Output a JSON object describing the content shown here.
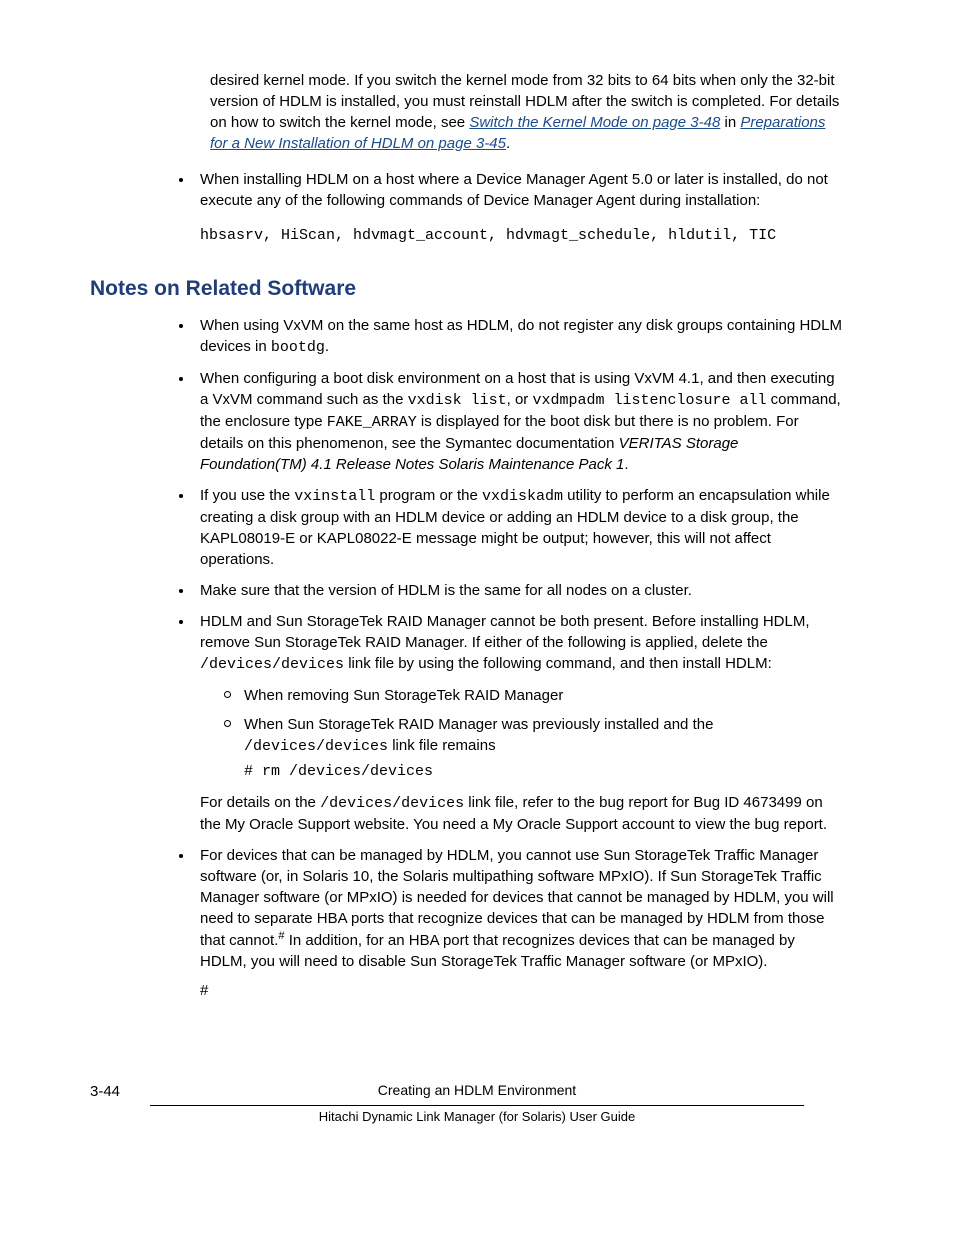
{
  "intro": {
    "p1_a": "desired kernel mode. If you switch the kernel mode from 32 bits to 64 bits when only the 32-bit version of HDLM is installed, you must reinstall HDLM after the switch is completed. For details on how to switch the kernel mode, see ",
    "link1": "Switch the Kernel Mode on page 3-48",
    "p1_b": " in ",
    "link2": "Preparations for a New Installation of HDLM on page 3-45",
    "p1_c": "."
  },
  "bullet_top": {
    "text": "When installing HDLM on a host where a Device Manager Agent 5.0 or later is installed, do not execute any of the following commands of Device Manager Agent during installation:",
    "code": "hbsasrv, HiScan, hdvmagt_account, hdvmagt_schedule, hldutil, TIC"
  },
  "heading": "Notes on Related Software",
  "notes": {
    "n1_a": "When using VxVM on the same host as HDLM, do not register any disk groups containing HDLM devices in ",
    "n1_code": "bootdg",
    "n1_b": ".",
    "n2_a": "When configuring a boot disk environment on a host that is using VxVM 4.1, and then executing a VxVM command such as the ",
    "n2_code1": "vxdisk list",
    "n2_b": ", or ",
    "n2_code2": "vxdmpadm listenclosure all",
    "n2_c": " command, the enclosure type ",
    "n2_code3": "FAKE_ARRAY",
    "n2_d": " is displayed for the boot disk but there is no problem. For details on this phenomenon, see the Symantec documentation ",
    "n2_italic": "VERITAS Storage Foundation(TM) 4.1 Release Notes Solaris Maintenance Pack 1",
    "n2_e": ".",
    "n3_a": "If you use the ",
    "n3_code1": "vxinstall",
    "n3_b": " program or the ",
    "n3_code2": "vxdiskadm",
    "n3_c": " utility to perform an encapsulation while creating a disk group with an HDLM device or adding an HDLM device to a disk group, the KAPL08019-E or KAPL08022-E message might be output; however, this will not affect operations.",
    "n4": "Make sure that the version of HDLM is the same for all nodes on a cluster.",
    "n5_a": "HDLM and Sun StorageTek RAID Manager cannot be both present. Before installing HDLM, remove Sun StorageTek RAID Manager. If either of the following is applied, delete the ",
    "n5_code1": "/devices/devices",
    "n5_b": " link file by using the following command, and then install HDLM:",
    "n5_sub1": "When removing Sun StorageTek RAID Manager",
    "n5_sub2_a": "When Sun StorageTek RAID Manager was previously installed and the ",
    "n5_sub2_code": "/devices/devices",
    "n5_sub2_b": " link file remains",
    "n5_cmd": "# rm /devices/devices",
    "n5_post_a": "For details on the ",
    "n5_post_code": "/devices/devices",
    "n5_post_b": " link file, refer to the bug report for Bug ID 4673499 on the My Oracle Support website. You need a My Oracle Support account to view the bug report.",
    "n6_a": "For devices that can be managed by HDLM, you cannot use Sun StorageTek Traffic Manager software (or, in Solaris 10, the Solaris multipathing software MPxIO). If Sun StorageTek Traffic Manager software (or MPxIO) is needed for devices that cannot be managed by HDLM, you will need to separate HBA ports that recognize devices that can be managed by HDLM from those that cannot.",
    "n6_sup": "#",
    "n6_b": " In addition, for an HBA port that recognizes devices that can be managed by HDLM, you will need to disable Sun StorageTek Traffic Manager software (or MPxIO).",
    "n6_hash": "#"
  },
  "footer": {
    "page": "3-44",
    "title": "Creating an HDLM Environment",
    "sub": "Hitachi Dynamic Link Manager (for Solaris) User Guide"
  }
}
